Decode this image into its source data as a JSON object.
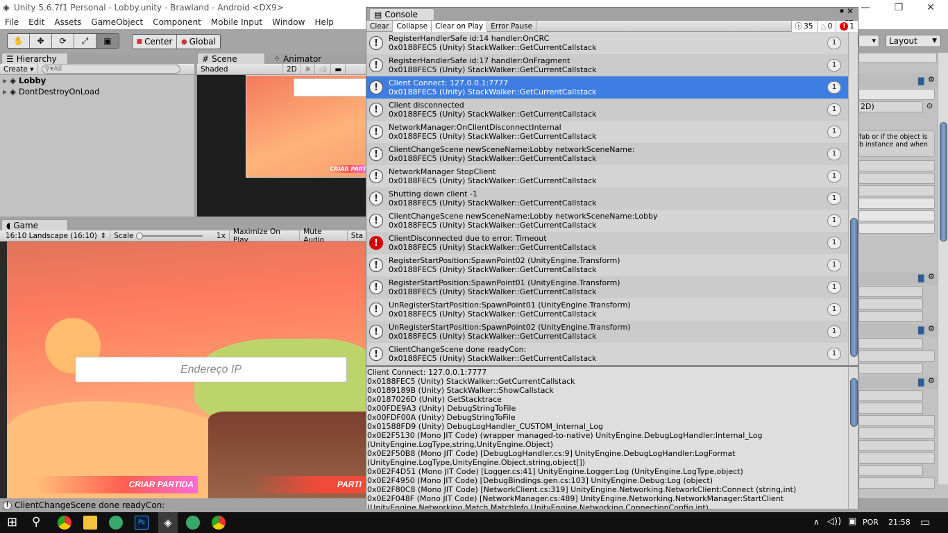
{
  "window": {
    "title": "Unity 5.6.7f1 Personal - Lobby.unity - Brawland - Android <DX9>",
    "minimize": "—",
    "restore": "❐",
    "close": "✕"
  },
  "menu": [
    "File",
    "Edit",
    "Assets",
    "GameObject",
    "Component",
    "Mobile Input",
    "Window",
    "Help"
  ],
  "toolbar": {
    "tools": [
      "hand-tool",
      "move-tool",
      "rotate-tool",
      "scale-tool",
      "rect-tool"
    ],
    "pivot": "Center",
    "space": "Global",
    "layers_arrow": "▾",
    "layout": "Layout"
  },
  "hierarchy": {
    "tab": "Hierarchy",
    "create": "Create",
    "search_placeholder": "All",
    "items": [
      {
        "label": "Lobby",
        "bold": true
      },
      {
        "label": "DontDestroyOnLoad",
        "bold": false
      }
    ]
  },
  "scene": {
    "tab": "Scene",
    "animator_tab": "Animator",
    "shading": "Shaded",
    "mode_2d": "2D"
  },
  "game": {
    "tab": "Game",
    "aspect": "16:10 Landscape (16:10)",
    "scale_label": "Scale",
    "scale_value": "1x",
    "maximize": "Maximize On Play",
    "mute": "Mute Audio",
    "stats": "Sta",
    "ip_placeholder": "Endereço IP",
    "create_button": "CRIAR PARTIDA",
    "join_button": "PARTI"
  },
  "status_bar": {
    "message": "ClientChangeScene done readyCon:"
  },
  "console": {
    "tab": "Console",
    "buttons": [
      "Clear",
      "Collapse",
      "Clear on Play",
      "Error Pause"
    ],
    "info_count": "35",
    "warning_count": "0",
    "error_count": "1",
    "selected_color": "#3e7de1",
    "entries": [
      {
        "type": "info",
        "line1": "RegisterHandlerSafe id:14 handler:OnCRC",
        "line2": "0x0188FEC5 (Unity) StackWalker::GetCurrentCallstack",
        "count": "1"
      },
      {
        "type": "info",
        "line1": "RegisterHandlerSafe id:17 handler:OnFragment",
        "line2": "0x0188FEC5 (Unity) StackWalker::GetCurrentCallstack",
        "count": "1"
      },
      {
        "type": "info",
        "line1": "Client Connect: 127.0.0.1:7777",
        "line2": "0x0188FEC5 (Unity) StackWalker::GetCurrentCallstack",
        "count": "1",
        "selected": true
      },
      {
        "type": "info",
        "line1": "Client disconnected",
        "line2": "0x0188FEC5 (Unity) StackWalker::GetCurrentCallstack",
        "count": "1"
      },
      {
        "type": "info",
        "line1": "NetworkManager:OnClientDisconnectInternal",
        "line2": "0x0188FEC5 (Unity) StackWalker::GetCurrentCallstack",
        "count": "1"
      },
      {
        "type": "info",
        "line1": "ClientChangeScene newSceneName:Lobby networkSceneName:",
        "line2": "0x0188FEC5 (Unity) StackWalker::GetCurrentCallstack",
        "count": "1"
      },
      {
        "type": "info",
        "line1": "NetworkManager StopClient",
        "line2": "0x0188FEC5 (Unity) StackWalker::GetCurrentCallstack",
        "count": "1"
      },
      {
        "type": "info",
        "line1": "Shutting down client -1",
        "line2": "0x0188FEC5 (Unity) StackWalker::GetCurrentCallstack",
        "count": "1"
      },
      {
        "type": "info",
        "line1": "ClientChangeScene newSceneName:Lobby networkSceneName:Lobby",
        "line2": "0x0188FEC5 (Unity) StackWalker::GetCurrentCallstack",
        "count": "1"
      },
      {
        "type": "error",
        "line1": "ClientDisconnected due to error: Timeout",
        "line2": "0x0188FEC5 (Unity) StackWalker::GetCurrentCallstack",
        "count": "1"
      },
      {
        "type": "info",
        "line1": "RegisterStartPosition:SpawnPoint02 (UnityEngine.Transform)",
        "line2": "0x0188FEC5 (Unity) StackWalker::GetCurrentCallstack",
        "count": "1"
      },
      {
        "type": "info",
        "line1": "RegisterStartPosition:SpawnPoint01 (UnityEngine.Transform)",
        "line2": "0x0188FEC5 (Unity) StackWalker::GetCurrentCallstack",
        "count": "1"
      },
      {
        "type": "info",
        "line1": "UnRegisterStartPosition:SpawnPoint01 (UnityEngine.Transform)",
        "line2": "0x0188FEC5 (Unity) StackWalker::GetCurrentCallstack",
        "count": "1"
      },
      {
        "type": "info",
        "line1": "UnRegisterStartPosition:SpawnPoint02 (UnityEngine.Transform)",
        "line2": "0x0188FEC5 (Unity) StackWalker::GetCurrentCallstack",
        "count": "1"
      },
      {
        "type": "info",
        "line1": "ClientChangeScene done readyCon:",
        "line2": "0x0188FEC5 (Unity) StackWalker::GetCurrentCallstack",
        "count": "1"
      }
    ],
    "detail": [
      "Client Connect: 127.0.0.1:7777",
      "0x0188FEC5 (Unity) StackWalker::GetCurrentCallstack",
      "0x0189189B (Unity) StackWalker::ShowCallstack",
      "0x0187026D (Unity) GetStacktrace",
      "0x00FDE9A3 (Unity) DebugStringToFile",
      "0x00FDF00A (Unity) DebugStringToFile",
      "0x01588FD9 (Unity) DebugLogHandler_CUSTOM_Internal_Log",
      "0x0E2F5130 (Mono JIT Code) (wrapper managed-to-native) UnityEngine.DebugLogHandler:Internal_Log",
      "(UnityEngine.LogType,string,UnityEngine.Object)",
      "0x0E2F50B8 (Mono JIT Code) [DebugLogHandler.cs:9] UnityEngine.DebugLogHandler:LogFormat",
      "(UnityEngine.LogType,UnityEngine.Object,string,object[])",
      "0x0E2F4D51 (Mono JIT Code) [Logger.cs:41] UnityEngine.Logger:Log (UnityEngine.LogType,object)",
      "0x0E2F4950 (Mono JIT Code) [DebugBindings.gen.cs:103] UnityEngine.Debug:Log (object)",
      "0x0E2F80C8 (Mono JIT Code) [NetworkClient.cs:319] UnityEngine.Networking.NetworkClient:Connect (string,int)",
      "0x0E2F048F (Mono JIT Code) [NetworkManager.cs:489] UnityEngine.Networking.NetworkManager:StartClient",
      "(UnityEngine.Networking.Match.MatchInfo,UnityEngine.Networking.ConnectionConfig,int)"
    ]
  },
  "inspector": {
    "field_fragment": "2D)",
    "help_text_1": "fab or if the object is",
    "help_text_2": "b instance and when"
  },
  "taskbar": {
    "language": "POR",
    "time": "21:58",
    "icons": [
      "start-icon",
      "search-icon",
      "chrome-icon",
      "explorer-icon",
      "app-icon",
      "photoshop-icon",
      "unity-icon",
      "app-icon",
      "chrome-icon"
    ]
  }
}
